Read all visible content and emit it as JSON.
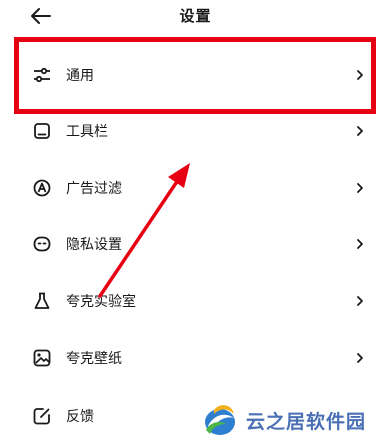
{
  "header": {
    "title": "设置",
    "back_icon": "arrow-left-icon"
  },
  "menu": {
    "items": [
      {
        "label": "通用",
        "icon": "sliders-icon"
      },
      {
        "label": "工具栏",
        "icon": "toolbar-icon"
      },
      {
        "label": "广告过滤",
        "icon": "ad-filter-icon"
      },
      {
        "label": "隐私设置",
        "icon": "privacy-icon"
      },
      {
        "label": "夸克实验室",
        "icon": "flask-icon"
      },
      {
        "label": "夸克壁纸",
        "icon": "wallpaper-icon"
      },
      {
        "label": "反馈",
        "icon": "feedback-icon"
      }
    ],
    "chevron_icon": "chevron-right-icon"
  },
  "annotation": {
    "highlight_color": "#e60012",
    "highlighted_item": "通用"
  },
  "watermark": {
    "text": "云之居软件园",
    "color": "#4a6fb5"
  }
}
